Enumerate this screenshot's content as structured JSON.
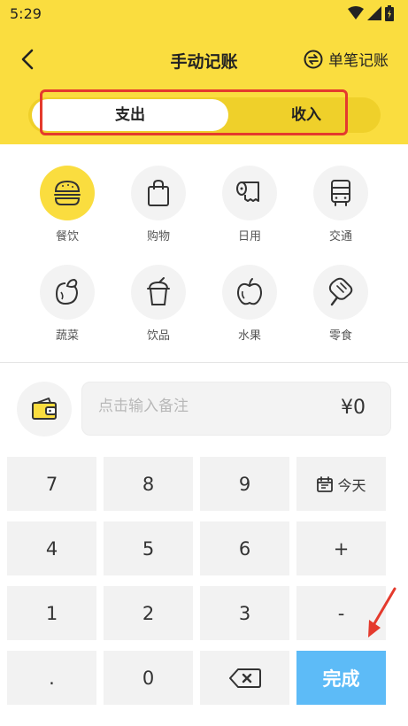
{
  "status": {
    "time": "5:29"
  },
  "nav": {
    "title": "手动记账",
    "single_entry": "单笔记账"
  },
  "tabs": [
    {
      "label": "支出"
    },
    {
      "label": "收入"
    }
  ],
  "categories": [
    {
      "label": "餐饮",
      "icon": "burger-icon"
    },
    {
      "label": "购物",
      "icon": "shopping-bag-icon"
    },
    {
      "label": "日用",
      "icon": "toilet-roll-icon"
    },
    {
      "label": "交通",
      "icon": "bus-icon"
    },
    {
      "label": "蔬菜",
      "icon": "vegetable-icon"
    },
    {
      "label": "饮品",
      "icon": "drink-cup-icon"
    },
    {
      "label": "水果",
      "icon": "apple-icon"
    },
    {
      "label": "零食",
      "icon": "popsicle-icon"
    }
  ],
  "note": {
    "placeholder": "点击输入备注",
    "amount": "¥0"
  },
  "keypad": {
    "k7": "7",
    "k8": "8",
    "k9": "9",
    "today": "今天",
    "k4": "4",
    "k5": "5",
    "k6": "6",
    "plus": "+",
    "k1": "1",
    "k2": "2",
    "k3": "3",
    "minus": "-",
    "dot": ".",
    "k0": "0",
    "done": "完成"
  },
  "colors": {
    "header": "#fadd3f",
    "done": "#5dbbf7",
    "highlight": "#e43a2d"
  }
}
